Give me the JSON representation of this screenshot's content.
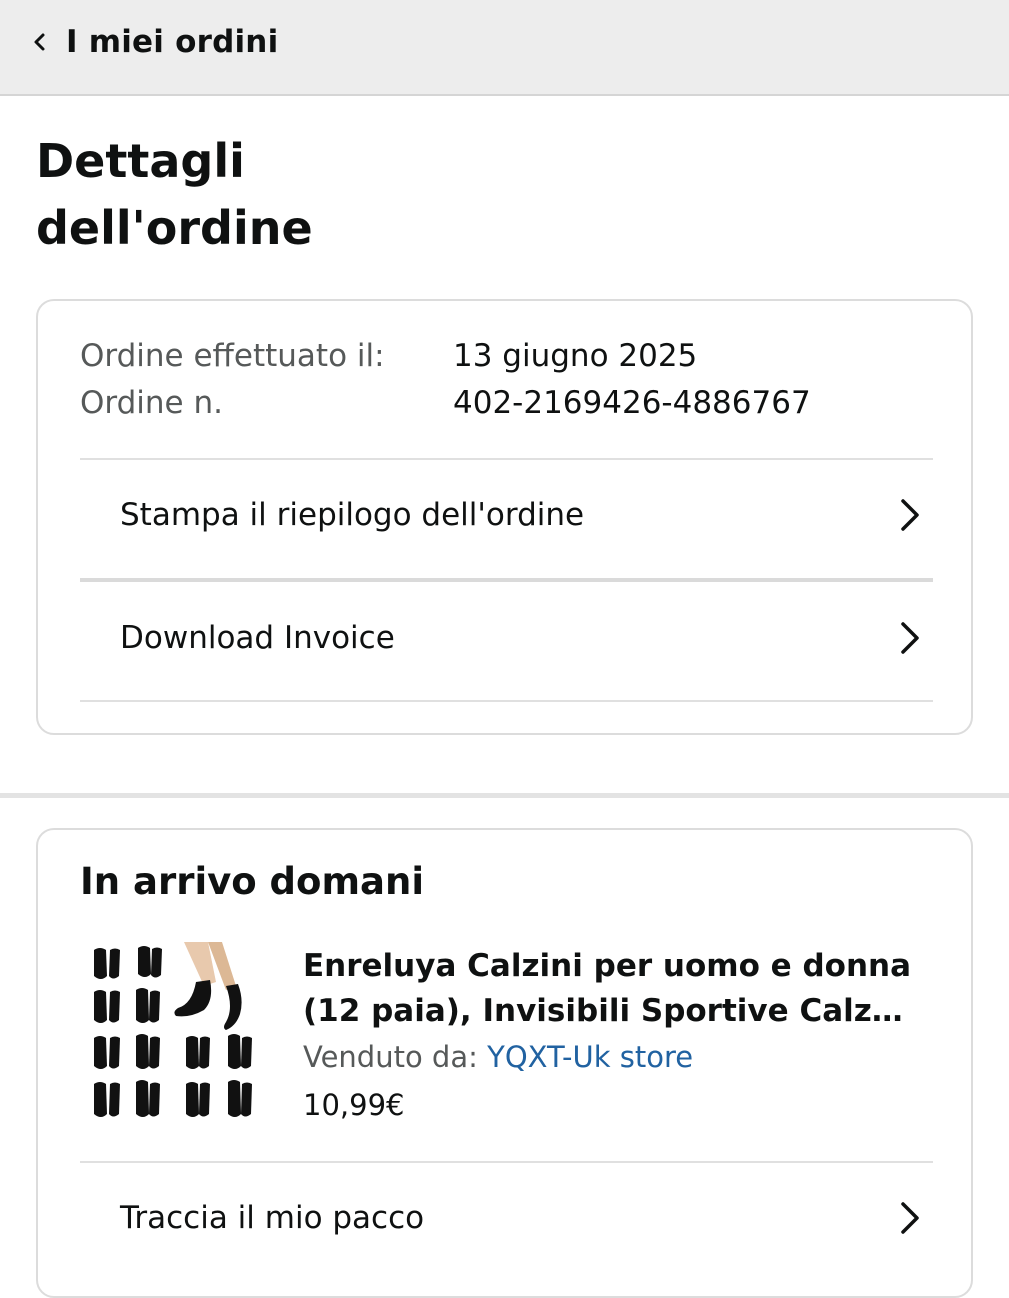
{
  "header": {
    "back_label": "I miei ordini",
    "back_icon": "chevron-left-icon"
  },
  "page_title": "Dettagli dell'ordine",
  "order_info": {
    "date_label": "Ordine effettuato il:",
    "date_value": "13 giugno 2025",
    "number_label": "Ordine n.",
    "number_value": "402-2169426-4886767"
  },
  "actions": {
    "print_summary": "Stampa il riepilogo dell'ordine",
    "download_invoice": "Download Invoice",
    "chevron_icon": "chevron-right-icon"
  },
  "shipment": {
    "status_title": "In arrivo domani",
    "product": {
      "title": "Enreluya Calzini per uomo e donna (12 paia), Invisibili Sportive Calze i...",
      "seller_label": "Venduto da:",
      "seller_name": "YQXT-Uk store",
      "price": "10,99€",
      "image_icon": "black-ankle-socks-product-image"
    },
    "track_label": "Traccia il mio pacco"
  },
  "colors": {
    "header_bg": "#ededed",
    "link": "#2162a1",
    "secondary_text": "#565959",
    "primary_text": "#0f1111"
  }
}
